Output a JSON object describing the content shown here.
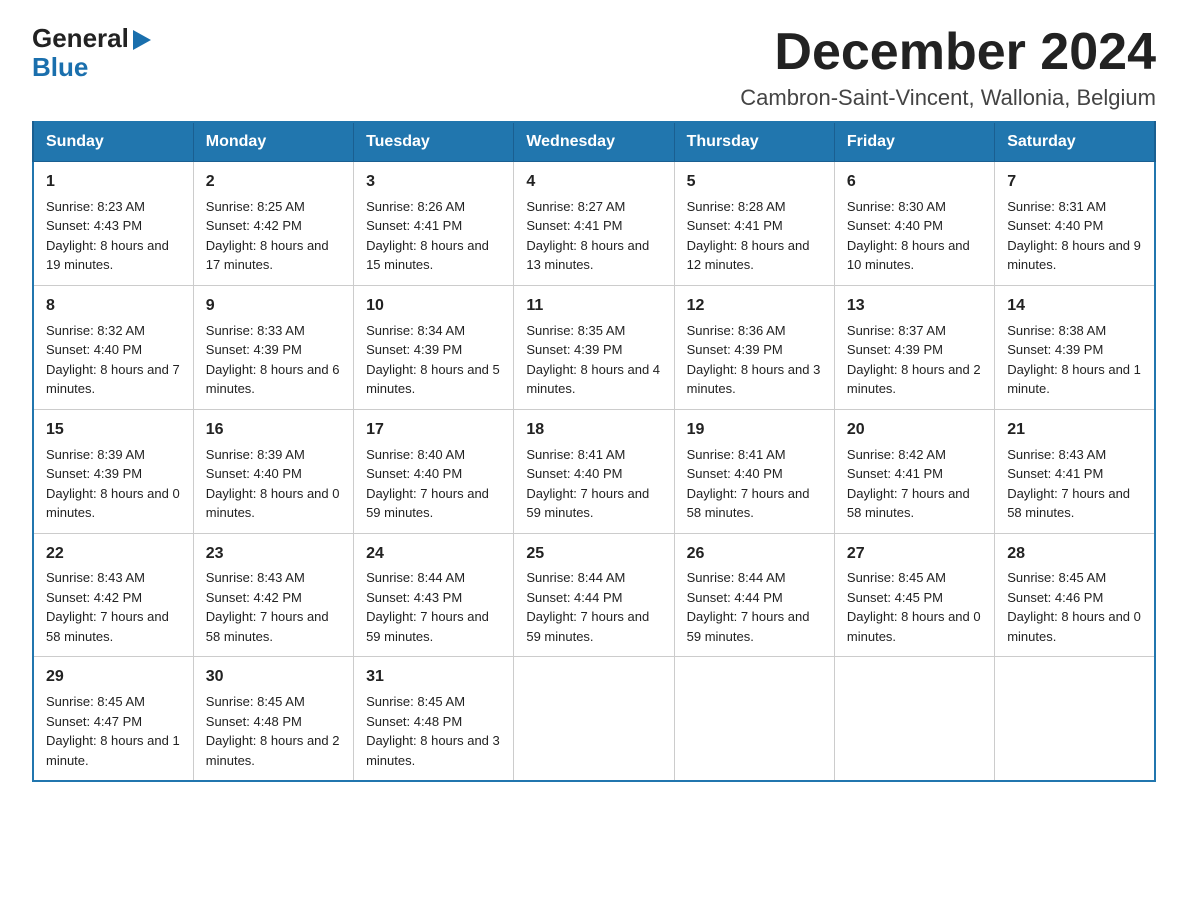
{
  "header": {
    "logo_general": "General",
    "logo_blue": "Blue",
    "month_title": "December 2024",
    "location": "Cambron-Saint-Vincent, Wallonia, Belgium"
  },
  "days_of_week": [
    "Sunday",
    "Monday",
    "Tuesday",
    "Wednesday",
    "Thursday",
    "Friday",
    "Saturday"
  ],
  "weeks": [
    [
      {
        "day": "1",
        "sunrise": "8:23 AM",
        "sunset": "4:43 PM",
        "daylight": "8 hours and 19 minutes."
      },
      {
        "day": "2",
        "sunrise": "8:25 AM",
        "sunset": "4:42 PM",
        "daylight": "8 hours and 17 minutes."
      },
      {
        "day": "3",
        "sunrise": "8:26 AM",
        "sunset": "4:41 PM",
        "daylight": "8 hours and 15 minutes."
      },
      {
        "day": "4",
        "sunrise": "8:27 AM",
        "sunset": "4:41 PM",
        "daylight": "8 hours and 13 minutes."
      },
      {
        "day": "5",
        "sunrise": "8:28 AM",
        "sunset": "4:41 PM",
        "daylight": "8 hours and 12 minutes."
      },
      {
        "day": "6",
        "sunrise": "8:30 AM",
        "sunset": "4:40 PM",
        "daylight": "8 hours and 10 minutes."
      },
      {
        "day": "7",
        "sunrise": "8:31 AM",
        "sunset": "4:40 PM",
        "daylight": "8 hours and 9 minutes."
      }
    ],
    [
      {
        "day": "8",
        "sunrise": "8:32 AM",
        "sunset": "4:40 PM",
        "daylight": "8 hours and 7 minutes."
      },
      {
        "day": "9",
        "sunrise": "8:33 AM",
        "sunset": "4:39 PM",
        "daylight": "8 hours and 6 minutes."
      },
      {
        "day": "10",
        "sunrise": "8:34 AM",
        "sunset": "4:39 PM",
        "daylight": "8 hours and 5 minutes."
      },
      {
        "day": "11",
        "sunrise": "8:35 AM",
        "sunset": "4:39 PM",
        "daylight": "8 hours and 4 minutes."
      },
      {
        "day": "12",
        "sunrise": "8:36 AM",
        "sunset": "4:39 PM",
        "daylight": "8 hours and 3 minutes."
      },
      {
        "day": "13",
        "sunrise": "8:37 AM",
        "sunset": "4:39 PM",
        "daylight": "8 hours and 2 minutes."
      },
      {
        "day": "14",
        "sunrise": "8:38 AM",
        "sunset": "4:39 PM",
        "daylight": "8 hours and 1 minute."
      }
    ],
    [
      {
        "day": "15",
        "sunrise": "8:39 AM",
        "sunset": "4:39 PM",
        "daylight": "8 hours and 0 minutes."
      },
      {
        "day": "16",
        "sunrise": "8:39 AM",
        "sunset": "4:40 PM",
        "daylight": "8 hours and 0 minutes."
      },
      {
        "day": "17",
        "sunrise": "8:40 AM",
        "sunset": "4:40 PM",
        "daylight": "7 hours and 59 minutes."
      },
      {
        "day": "18",
        "sunrise": "8:41 AM",
        "sunset": "4:40 PM",
        "daylight": "7 hours and 59 minutes."
      },
      {
        "day": "19",
        "sunrise": "8:41 AM",
        "sunset": "4:40 PM",
        "daylight": "7 hours and 58 minutes."
      },
      {
        "day": "20",
        "sunrise": "8:42 AM",
        "sunset": "4:41 PM",
        "daylight": "7 hours and 58 minutes."
      },
      {
        "day": "21",
        "sunrise": "8:43 AM",
        "sunset": "4:41 PM",
        "daylight": "7 hours and 58 minutes."
      }
    ],
    [
      {
        "day": "22",
        "sunrise": "8:43 AM",
        "sunset": "4:42 PM",
        "daylight": "7 hours and 58 minutes."
      },
      {
        "day": "23",
        "sunrise": "8:43 AM",
        "sunset": "4:42 PM",
        "daylight": "7 hours and 58 minutes."
      },
      {
        "day": "24",
        "sunrise": "8:44 AM",
        "sunset": "4:43 PM",
        "daylight": "7 hours and 59 minutes."
      },
      {
        "day": "25",
        "sunrise": "8:44 AM",
        "sunset": "4:44 PM",
        "daylight": "7 hours and 59 minutes."
      },
      {
        "day": "26",
        "sunrise": "8:44 AM",
        "sunset": "4:44 PM",
        "daylight": "7 hours and 59 minutes."
      },
      {
        "day": "27",
        "sunrise": "8:45 AM",
        "sunset": "4:45 PM",
        "daylight": "8 hours and 0 minutes."
      },
      {
        "day": "28",
        "sunrise": "8:45 AM",
        "sunset": "4:46 PM",
        "daylight": "8 hours and 0 minutes."
      }
    ],
    [
      {
        "day": "29",
        "sunrise": "8:45 AM",
        "sunset": "4:47 PM",
        "daylight": "8 hours and 1 minute."
      },
      {
        "day": "30",
        "sunrise": "8:45 AM",
        "sunset": "4:48 PM",
        "daylight": "8 hours and 2 minutes."
      },
      {
        "day": "31",
        "sunrise": "8:45 AM",
        "sunset": "4:48 PM",
        "daylight": "8 hours and 3 minutes."
      },
      null,
      null,
      null,
      null
    ]
  ]
}
